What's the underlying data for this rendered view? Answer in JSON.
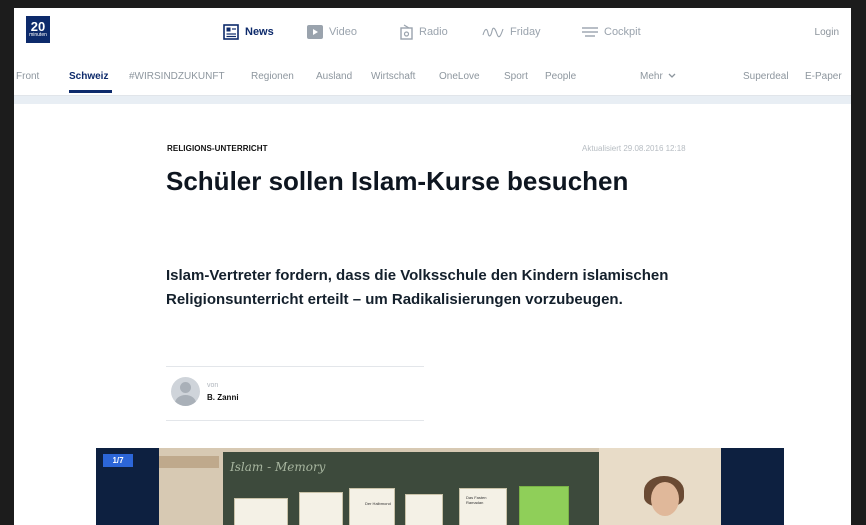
{
  "logo": {
    "text": "20",
    "sub": "minuten"
  },
  "topnav": {
    "items": [
      {
        "label": "News",
        "icon": "news-icon",
        "active": true
      },
      {
        "label": "Video",
        "icon": "video-play-icon",
        "active": false
      },
      {
        "label": "Radio",
        "icon": "radio-icon",
        "active": false
      },
      {
        "label": "Friday",
        "icon": "friday-logo-icon",
        "active": false
      },
      {
        "label": "Cockpit",
        "icon": "hamburger-menu-icon",
        "active": false
      }
    ],
    "login": "Login"
  },
  "subnav": {
    "items": [
      "Front",
      "Schweiz",
      "#WIRSINDZUKUNFT",
      "Regionen",
      "Ausland",
      "Wirtschaft",
      "OneLove",
      "Sport",
      "People"
    ],
    "active": "Schweiz",
    "more": "Mehr",
    "right": [
      "Superdeal",
      "E-Paper"
    ]
  },
  "article": {
    "kicker": "RELIGIONS-UNTERRICHT",
    "date": "Aktualisiert 29.08.2016 12:18",
    "headline": "Schüler sollen Islam-Kurse besuchen",
    "lead": "Islam-Vertreter fordern, dass die Volksschule den Kindern islamischen Religionsunterricht erteilt – um Radikalisierungen vorzubeugen.",
    "byline_prefix": "von",
    "author": "B. Zanni"
  },
  "gallery": {
    "counter": "1/7",
    "board_text": "Islam - Memory",
    "card_labels": [
      "Der Halbmond",
      "Das Fasten Ramadan"
    ]
  },
  "colors": {
    "brand": "#0d2a6b",
    "accent": "#2c66d8"
  }
}
